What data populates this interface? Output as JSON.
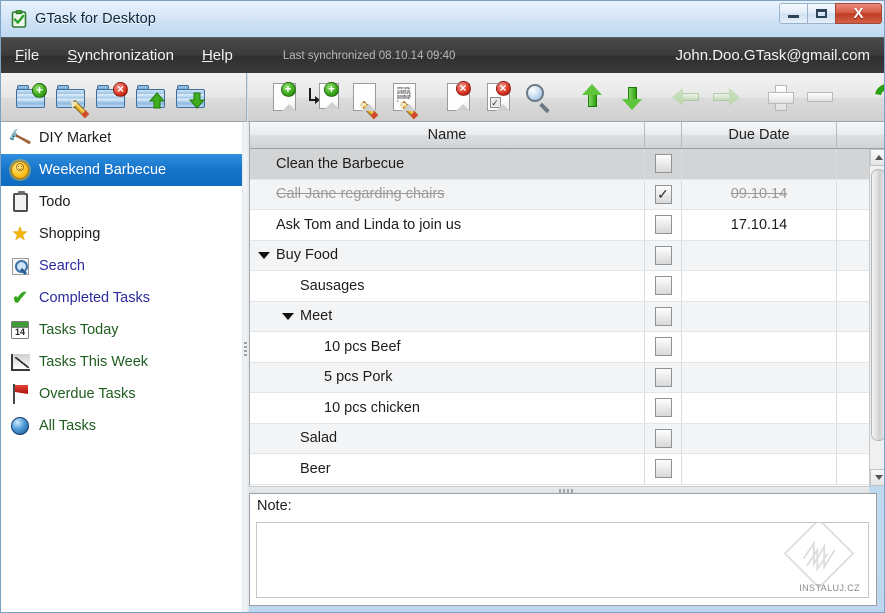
{
  "window": {
    "title": "GTask for Desktop",
    "app_icon": "clipboard-check-icon",
    "controls": {
      "minimize": "minimize-icon",
      "maximize": "maximize-icon",
      "close_label": "X"
    }
  },
  "menubar": {
    "items": [
      {
        "mnemonic": "F",
        "rest": "ile"
      },
      {
        "mnemonic": "S",
        "rest": "ynchronization"
      },
      {
        "mnemonic": "H",
        "rest": "elp"
      }
    ],
    "sync_status": "Last synchronized 08.10.14 09:40",
    "account": "John.Doo.GTask@gmail.com"
  },
  "toolbar_left": {
    "buttons": [
      {
        "name": "add-list-button",
        "icon": "folder-add-icon"
      },
      {
        "name": "edit-list-button",
        "icon": "folder-edit-icon"
      },
      {
        "name": "delete-list-button",
        "icon": "folder-delete-icon"
      },
      {
        "name": "move-list-up-button",
        "icon": "folder-up-icon"
      },
      {
        "name": "move-list-down-button",
        "icon": "folder-down-icon"
      }
    ]
  },
  "toolbar_right": {
    "buttons": [
      {
        "name": "new-task-button",
        "icon": "page-add-icon"
      },
      {
        "name": "new-subtask-button",
        "icon": "page-subtask-add-icon"
      },
      {
        "name": "edit-task-button",
        "icon": "page-edit-icon"
      },
      {
        "name": "edit-task-note-button",
        "icon": "page-text-edit-icon"
      },
      {
        "name": "delete-task-button",
        "icon": "page-delete-icon"
      },
      {
        "name": "delete-completed-button",
        "icon": "page-checked-delete-icon"
      },
      {
        "name": "search-task-button",
        "icon": "magnifier-icon"
      },
      {
        "name": "move-task-up-button",
        "icon": "arrow-up-icon"
      },
      {
        "name": "move-task-down-button",
        "icon": "arrow-down-icon"
      },
      {
        "name": "outdent-task-button",
        "icon": "arrow-left-icon"
      },
      {
        "name": "indent-task-button",
        "icon": "arrow-right-icon"
      },
      {
        "name": "expand-all-button",
        "icon": "plus-icon"
      },
      {
        "name": "collapse-all-button",
        "icon": "minus-icon"
      },
      {
        "name": "synchronize-button",
        "icon": "refresh-icon"
      }
    ]
  },
  "sidebar": {
    "items": [
      {
        "label": "DIY Market",
        "icon": "hammer-icon",
        "style": "dark",
        "selected": false
      },
      {
        "label": "Weekend Barbecue",
        "icon": "smiley-sun-icon",
        "style": "dark",
        "selected": true
      },
      {
        "label": "Todo",
        "icon": "clipboard-icon",
        "style": "dark",
        "selected": false
      },
      {
        "label": "Shopping",
        "icon": "star-icon",
        "style": "dark",
        "selected": false
      },
      {
        "label": "Search",
        "icon": "magnifier-icon",
        "style": "link",
        "selected": false
      },
      {
        "label": "Completed Tasks",
        "icon": "green-check-icon",
        "style": "link",
        "selected": false
      },
      {
        "label": "Tasks Today",
        "icon": "calendar-14-icon",
        "style": "green",
        "selected": false
      },
      {
        "label": "Tasks This Week",
        "icon": "week-chart-icon",
        "style": "green",
        "selected": false
      },
      {
        "label": "Overdue Tasks",
        "icon": "red-flag-icon",
        "style": "green",
        "selected": false
      },
      {
        "label": "All Tasks",
        "icon": "globe-icon",
        "style": "green",
        "selected": false
      }
    ]
  },
  "tasklist": {
    "columns": {
      "name": "Name",
      "check": "",
      "due": "Due Date"
    },
    "rows": [
      {
        "name": "Clean the Barbecue",
        "indent": 0,
        "expander": "none",
        "checked": false,
        "due": "",
        "selected": true,
        "done": false
      },
      {
        "name": "Call Jane regarding chairs",
        "indent": 0,
        "expander": "none",
        "checked": true,
        "due": "09.10.14",
        "selected": false,
        "done": true
      },
      {
        "name": "Ask Tom and Linda to join us",
        "indent": 0,
        "expander": "none",
        "checked": false,
        "due": "17.10.14",
        "selected": false,
        "done": false
      },
      {
        "name": "Buy Food",
        "indent": 0,
        "expander": "expanded",
        "checked": false,
        "due": "",
        "selected": false,
        "done": false
      },
      {
        "name": "Sausages",
        "indent": 1,
        "expander": "none",
        "checked": false,
        "due": "",
        "selected": false,
        "done": false
      },
      {
        "name": "Meet",
        "indent": 1,
        "expander": "expanded",
        "checked": false,
        "due": "",
        "selected": false,
        "done": false
      },
      {
        "name": "10 pcs Beef",
        "indent": 2,
        "expander": "none",
        "checked": false,
        "due": "",
        "selected": false,
        "done": false
      },
      {
        "name": "5 pcs Pork",
        "indent": 2,
        "expander": "none",
        "checked": false,
        "due": "",
        "selected": false,
        "done": false
      },
      {
        "name": "10 pcs chicken",
        "indent": 2,
        "expander": "none",
        "checked": false,
        "due": "",
        "selected": false,
        "done": false
      },
      {
        "name": "Salad",
        "indent": 1,
        "expander": "none",
        "checked": false,
        "due": "",
        "selected": false,
        "done": false
      },
      {
        "name": "Beer",
        "indent": 1,
        "expander": "none",
        "checked": false,
        "due": "",
        "selected": false,
        "done": false
      }
    ],
    "checkmark": "✓"
  },
  "note": {
    "label": "Note:",
    "value": "",
    "watermark": "INSTALUJ.CZ"
  }
}
